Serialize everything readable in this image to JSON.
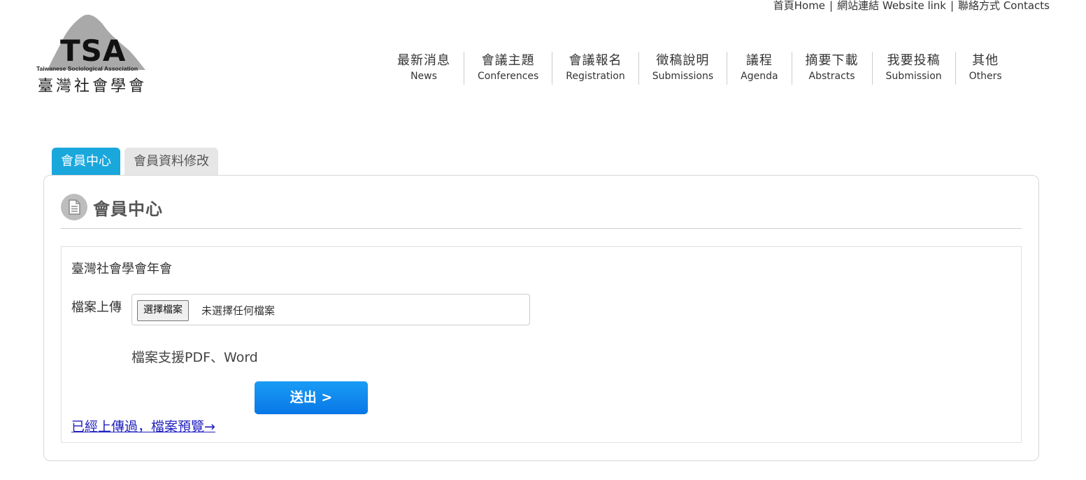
{
  "top_links": {
    "home": "首頁Home",
    "website_link": "網站連結 Website link",
    "contacts": "聯絡方式 Contacts",
    "separator": "|"
  },
  "logo": {
    "abbr": "TSA",
    "english": "Taiwanese Sociological Association",
    "chinese": "臺灣社會學會"
  },
  "nav": [
    {
      "zh": "最新消息",
      "en": "News"
    },
    {
      "zh": "會議主題",
      "en": "Conferences"
    },
    {
      "zh": "會議報名",
      "en": "Registration"
    },
    {
      "zh": "徵稿說明",
      "en": "Submissions"
    },
    {
      "zh": "議程",
      "en": "Agenda"
    },
    {
      "zh": "摘要下載",
      "en": "Abstracts"
    },
    {
      "zh": "我要投稿",
      "en": "Submission"
    },
    {
      "zh": "其他",
      "en": "Others"
    }
  ],
  "tabs": [
    {
      "label": "會員中心",
      "active": true
    },
    {
      "label": "會員資料修改",
      "active": false
    }
  ],
  "panel": {
    "title": "會員中心",
    "form": {
      "subtitle": "臺灣社會學會年會",
      "upload_label": "檔案上傳",
      "file_button": "選擇檔案",
      "file_status": "未選擇任何檔案",
      "support_note": "檔案支援PDF、Word",
      "submit": "送出 >",
      "preview_link": "已經上傳過，檔案預覽→"
    }
  },
  "colors": {
    "tab_active": "#1aa7dc",
    "submit_button": "#0877e6",
    "link": "#1f1fbf"
  }
}
